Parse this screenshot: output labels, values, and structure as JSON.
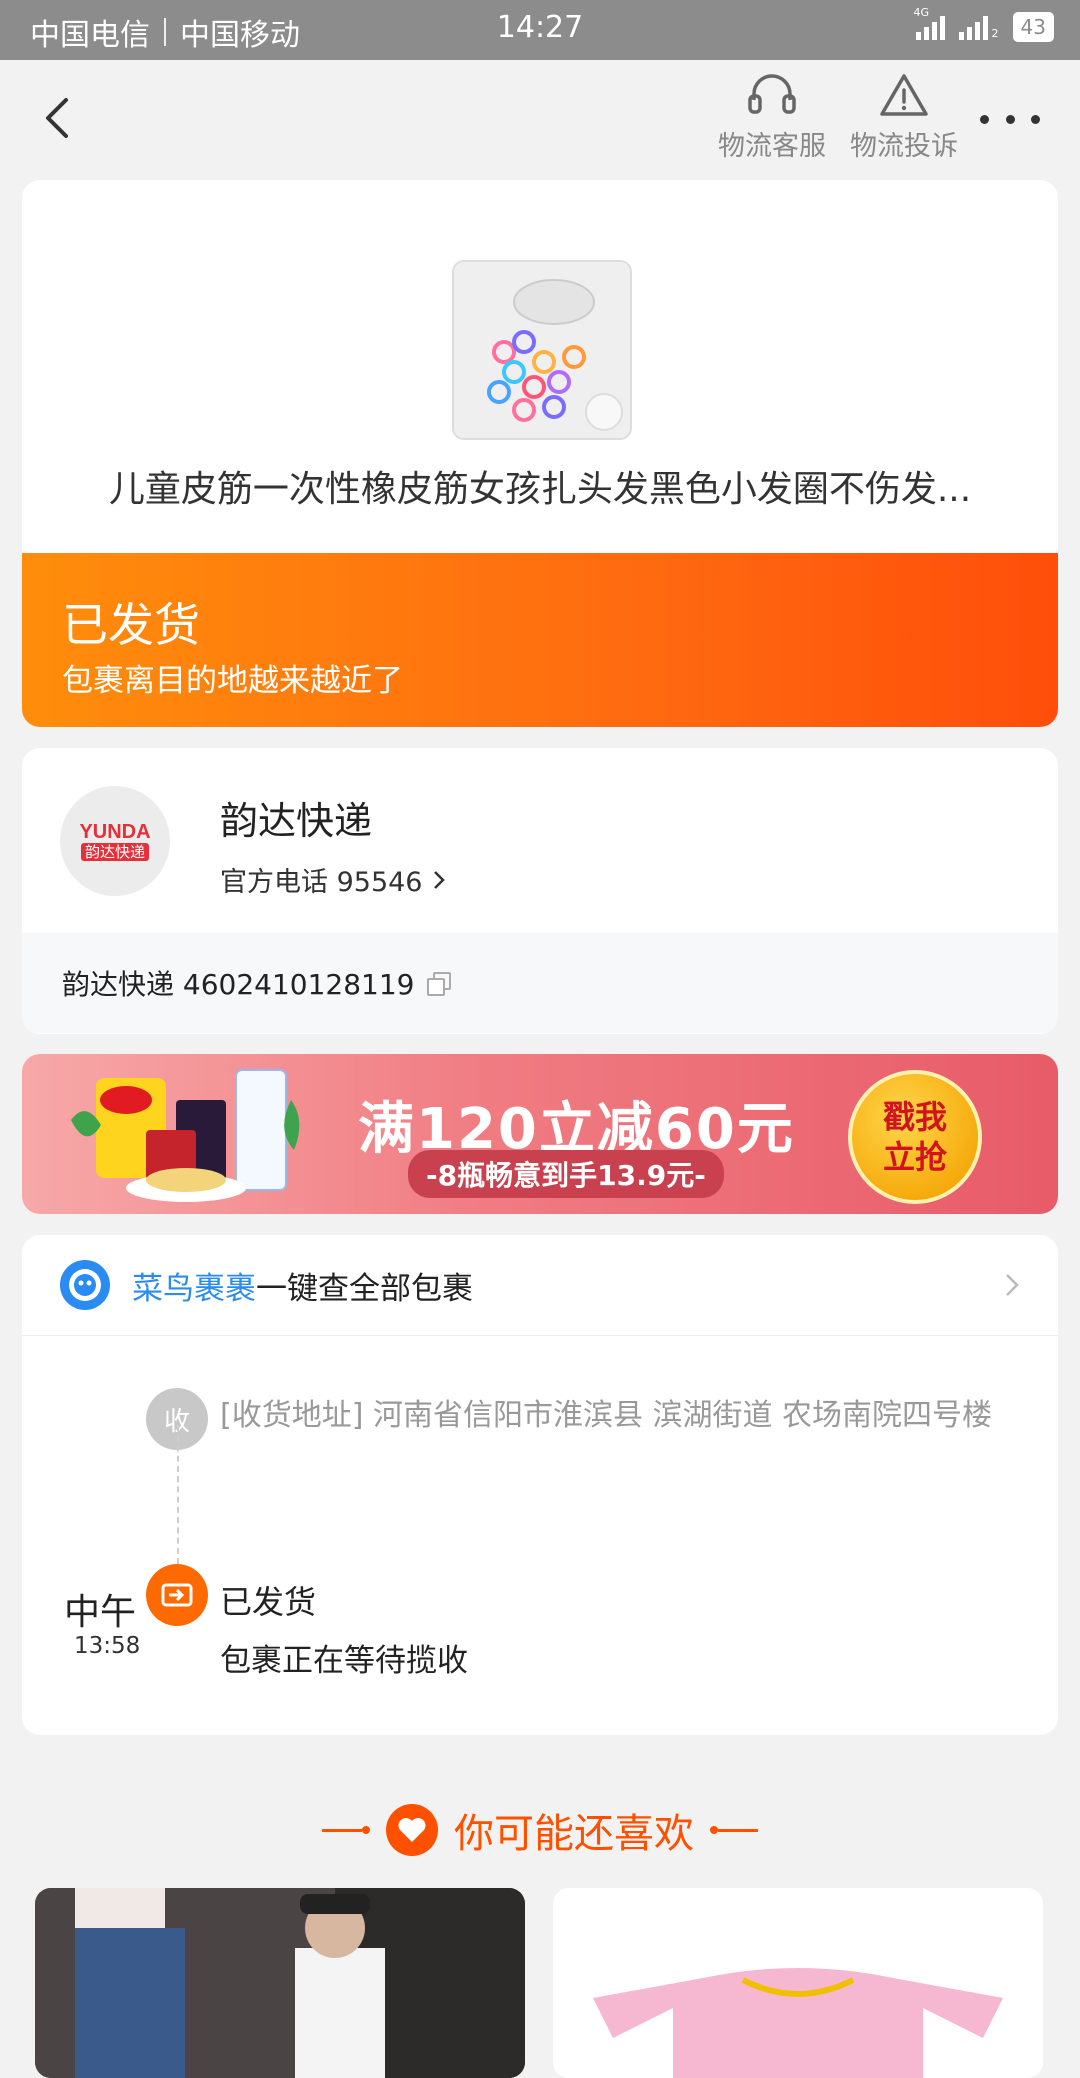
{
  "status_bar": {
    "carrier1": "中国电信",
    "carrier2": "中国移动",
    "time": "14:27",
    "network": "4G",
    "sim2_label": "2",
    "battery": "43"
  },
  "nav": {
    "service_label": "物流客服",
    "complaint_label": "物流投诉"
  },
  "product": {
    "title": "儿童皮筋一次性橡皮筋女孩扎头发黑色小发圈不伤发..."
  },
  "shipping": {
    "status": "已发货",
    "subtitle": "包裹离目的地越来越近了",
    "accent": "#ff6a10"
  },
  "courier": {
    "logo_text": "YUNDA",
    "logo_cn": "韵达快递",
    "name": "韵达快递",
    "phone_label": "官方电话 95546",
    "tracking": "韵达快递 4602410128119"
  },
  "ad": {
    "headline": "满120立减60元",
    "subline": "-8瓶畅意到手13.9元-",
    "button": "戳我立抢"
  },
  "cainiao": {
    "brand": "菜鸟裹裹",
    "text": "一键查全部包裹",
    "brand_color": "#2a8cf0"
  },
  "timeline": {
    "receive_badge": "收",
    "address": "[收货地址] 河南省信阳市淮滨县 滨湖街道   农场南院四号楼",
    "time_label": "中午",
    "time": "13:58",
    "status": "已发货",
    "desc": "包裹正在等待揽收"
  },
  "recommend": {
    "title": "你可能还喜欢"
  }
}
